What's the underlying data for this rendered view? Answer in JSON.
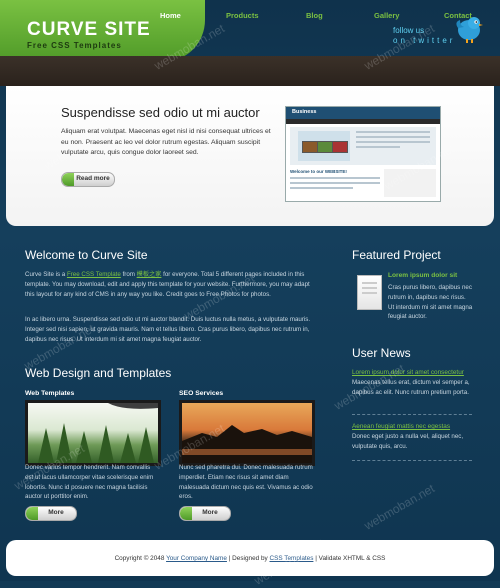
{
  "header": {
    "logo_title": "CURVE SITE",
    "logo_subtitle": "Free CSS Templates",
    "follow_line1": "follow us",
    "follow_line2": "on twitter"
  },
  "nav": {
    "items": [
      "Home",
      "Products",
      "Blog",
      "Gallery",
      "Contact"
    ],
    "active": "Home"
  },
  "hero": {
    "title": "Suspendisse sed odio ut mi auctor",
    "text": "Aliquam erat volutpat. Maecenas eget nisl id nisi consequat ultrices et eu non. Praesent ac leo vel dolor rutrum egestas. Aliquam suscipit vulputate arcu, quis congue dolor laoreet sed.",
    "button": "Read more",
    "preview": {
      "title": "Business",
      "welcome": "Welcome to our WEBSITE!"
    }
  },
  "welcome": {
    "title": "Welcome to Curve Site",
    "p1_pre": "Curve Site is a ",
    "p1_link": "Free CSS Template",
    "p1_mid": " from ",
    "p1_link2": "模板之家",
    "p1_post": " for everyone. Total 5 different pages included in this template. You may download, edit and apply this template for your website. Furthermore, you may adapt this layout for any kind of CMS in any way you like. Credit goes to Free Photos for photos.",
    "p2": "In ac libero urna. Suspendisse sed odio ut mi auctor blandit. Duis luctus nulla metus, a vulputate mauris. Integer sed nisi sapien, ut gravida mauris. Nam et tellus libero. Cras purus libero, dapibus nec rutrum in, dapibus nec risus. Ut interdum mi sit amet magna feugiat auctor."
  },
  "design": {
    "title": "Web Design and Templates",
    "col1": {
      "heading": "Web Templates",
      "text": "Donec varius tempor hendrerit. Nam convallis est ut lacus ullamcorper vitae scelerisque enim lobortis. Nunc id posuere nec magna facilisis auctor ut porttitor enim.",
      "button": "More"
    },
    "col2": {
      "heading": "SEO Services",
      "text": "Nunc sed pharetra dui. Donec malesuada rutrum imperdiet. Etiam nec risus sit amet diam malesuada dictum nec quis est. Vivamus ac odio eros.",
      "button": "More"
    }
  },
  "featured": {
    "title": "Featured Project",
    "link": "Lorem ipsum dolor sit",
    "text": "Cras purus libero, dapibus nec rutrum in, dapibus nec risus. Ut interdum mi sit amet magna feugiat auctor."
  },
  "news": {
    "title": "User News",
    "items": [
      {
        "link": "Lorem ipsum dolor sit amet consectetur",
        "text": "Maecenas tellus erat, dictum vel semper a, dapibus ac elit. Nunc rutrum pretium porta."
      },
      {
        "link": "Aenean feugiat mattis nec egestas",
        "text": "Donec eget justo a nulla vel, aliquet nec, vulputate quis, arcu."
      }
    ]
  },
  "footer": {
    "copyright": "Copyright © 2048",
    "company": "Your Company Name",
    "designed_by": "Designed by",
    "templates": "CSS Templates",
    "validate": "Validate XHTML & CSS",
    "sep": "|"
  },
  "watermark": "webmoban.net",
  "colors": {
    "accent": "#7bc142",
    "background": "#123a55",
    "nav": "#2e2620"
  }
}
